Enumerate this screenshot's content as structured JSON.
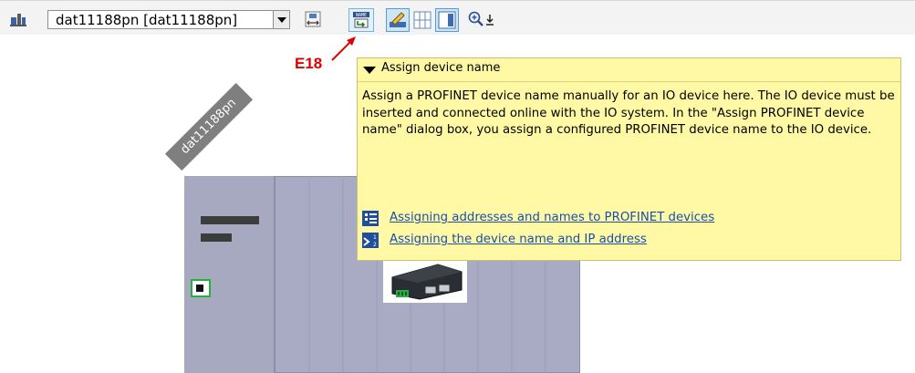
{
  "toolbar": {
    "device_select": {
      "value": "dat11188pn [dat11188pn]"
    },
    "icons": [
      "network-view-icon",
      "fit-view-icon",
      "assign-name-icon",
      "edit-icon",
      "grid-icon",
      "panel-icon",
      "zoom-icon"
    ]
  },
  "callout": {
    "label": "E18",
    "color": "#e00000"
  },
  "device": {
    "name": "dat11188pn"
  },
  "tooltip": {
    "title": "Assign device name",
    "body": "Assign a PROFINET device name manually for an IO device here. The IO device must be inserted and connected online with the IO system. In the \"Assign PROFINET device name\" dialog box, you assign a configured PROFINET device name to the IO device.",
    "links": [
      {
        "label": "Assigning addresses and names to PROFINET devices",
        "icon": "document-list-icon"
      },
      {
        "label": "Assigning the device name and IP address",
        "icon": "step-sequence-icon"
      }
    ]
  },
  "colors": {
    "tooltip_bg": "#fff9a6",
    "link": "#1a4fa8",
    "rack": "#a9abc5",
    "port_border": "#23b23a"
  }
}
